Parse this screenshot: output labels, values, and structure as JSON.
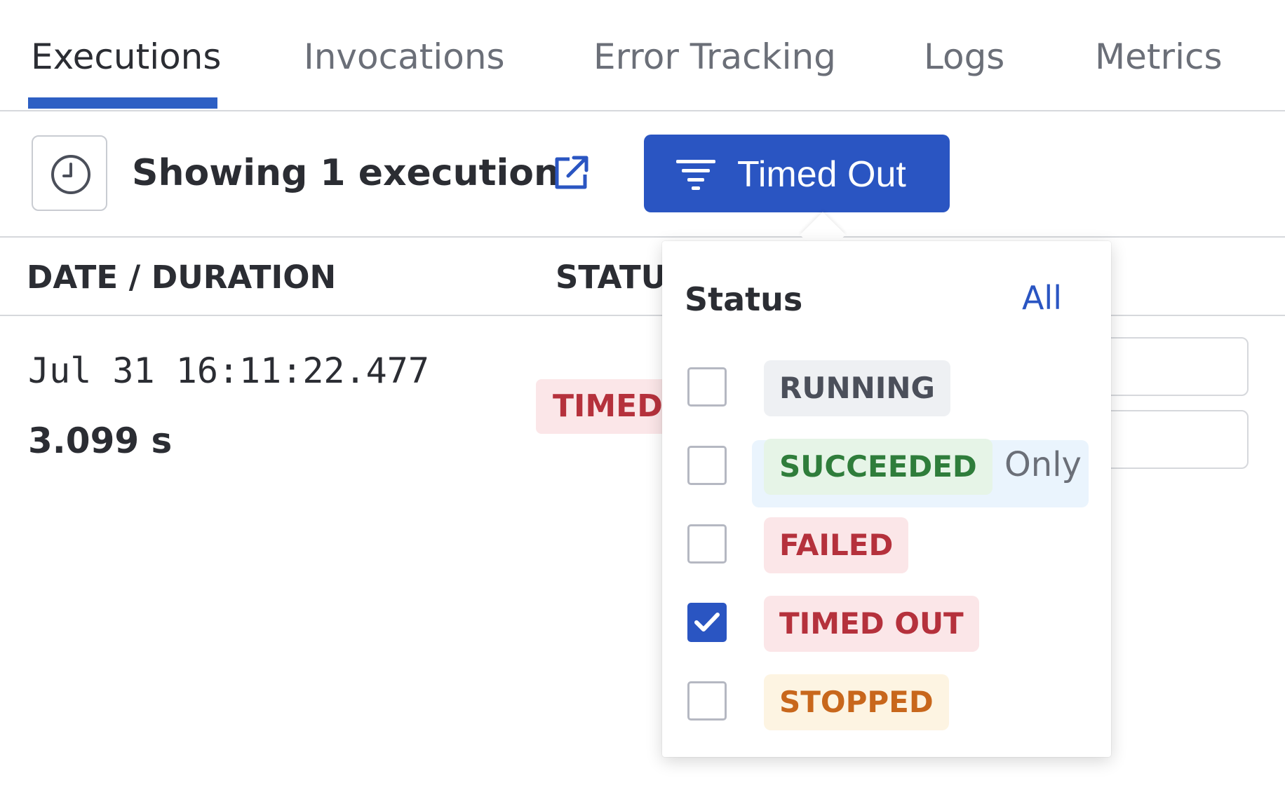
{
  "tabs": [
    {
      "label": "Executions",
      "active": true
    },
    {
      "label": "Invocations",
      "active": false
    },
    {
      "label": "Error Tracking",
      "active": false
    },
    {
      "label": "Logs",
      "active": false
    },
    {
      "label": "Metrics",
      "active": false
    }
  ],
  "toolbar": {
    "showing_text": "Showing 1 execution",
    "filter_label": "Timed Out"
  },
  "table": {
    "headers": [
      "DATE / DURATION",
      "STATUS"
    ],
    "rows": [
      {
        "date": "Jul 31 16:11:22.477",
        "duration": "3.099 s",
        "status": "TIMED OUT"
      }
    ]
  },
  "popover": {
    "title": "Status",
    "all_label": "All",
    "only_label": "Only",
    "options": [
      {
        "label": "RUNNING",
        "checked": false,
        "color": "#4b4f5a",
        "bg": "#eef0f3"
      },
      {
        "label": "SUCCEEDED",
        "checked": false,
        "color": "#2f7d3b",
        "bg": "#e6f4e7"
      },
      {
        "label": "FAILED",
        "checked": false,
        "color": "#b5313c",
        "bg": "#fbe6e8"
      },
      {
        "label": "TIMED OUT",
        "checked": true,
        "color": "#b5313c",
        "bg": "#fbe6e8"
      },
      {
        "label": "STOPPED",
        "checked": false,
        "color": "#c8671c",
        "bg": "#fdf4e2"
      }
    ]
  },
  "colors": {
    "accent": "#2a55c2",
    "border": "#d6d8dc"
  },
  "icons": [
    "clock-icon",
    "external-link-icon",
    "filter-icon",
    "checkmark-icon"
  ]
}
